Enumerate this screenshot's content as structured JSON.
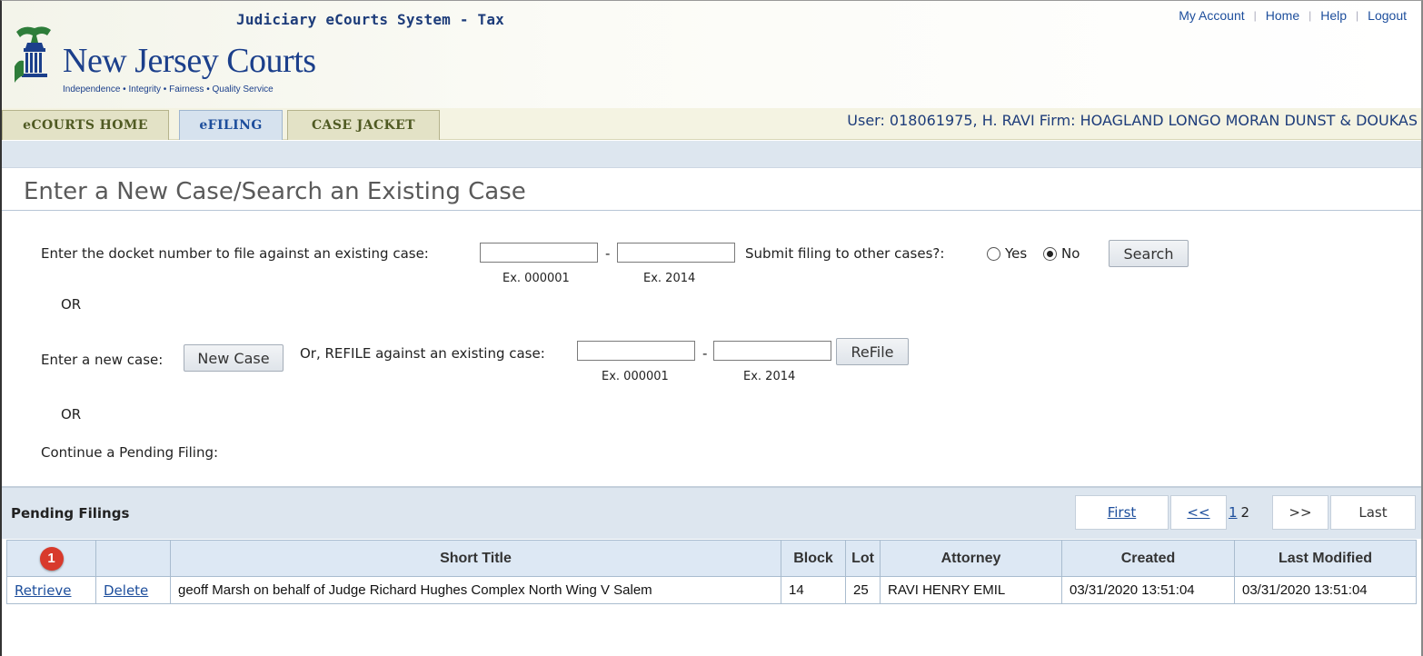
{
  "header": {
    "system_title": "Judiciary eCourts System - Tax",
    "links": [
      "My Account",
      "Home",
      "Help",
      "Logout"
    ],
    "logo_text": "New Jersey Courts",
    "logo_tagline": "Independence • Integrity • Fairness • Quality Service"
  },
  "tabs": [
    "eCOURTS HOME",
    "eFILING",
    "CASE JACKET"
  ],
  "active_tab": "eFILING",
  "user_info": "User: 018061975, H. RAVI  Firm: HOAGLAND LONGO MORAN DUNST & DOUKAS",
  "page_title": "Enter a New Case/Search an Existing Case",
  "existing_case": {
    "label": "Enter the docket number to file against an existing case:",
    "docket_value": "",
    "year_value": "",
    "separator": "-",
    "docket_hint": "Ex. 000001",
    "year_hint": "Ex. 2014",
    "other_cases_label": "Submit filing to other cases?:",
    "yes_label": "Yes",
    "no_label": "No",
    "selected": "No",
    "search_button": "Search"
  },
  "or_label": "OR",
  "new_case": {
    "label": "Enter a new case:",
    "button": "New Case",
    "refile_label": "Or, REFILE against an existing case:",
    "docket_value": "",
    "year_value": "",
    "separator": "-",
    "docket_hint": "Ex. 000001",
    "year_hint": "Ex. 2014",
    "refile_button": "ReFile"
  },
  "pending": {
    "continue_label": "Continue a Pending Filing:",
    "section_title": "Pending Filings",
    "pager": {
      "first": "First",
      "prev": "<<",
      "pages": [
        "1",
        "2"
      ],
      "next": ">>",
      "last": "Last"
    },
    "columns": [
      "",
      "",
      "Short Title",
      "Block",
      "Lot",
      "Attorney",
      "Created",
      "Last Modified"
    ],
    "badge": "1",
    "rows": [
      {
        "retrieve": "Retrieve",
        "delete": "Delete",
        "short_title": "geoff Marsh on behalf of Judge Richard Hughes Complex North Wing V Salem",
        "block": "14",
        "lot": "25",
        "attorney": "RAVI HENRY EMIL",
        "created": "03/31/2020 13:51:04",
        "last_modified": "03/31/2020 13:51:04"
      }
    ]
  },
  "colors": {
    "brand_blue": "#1b3f8b",
    "link_blue": "#1d4e9c",
    "badge_red": "#d83a2c",
    "tab_olive": "#4f5a22"
  }
}
